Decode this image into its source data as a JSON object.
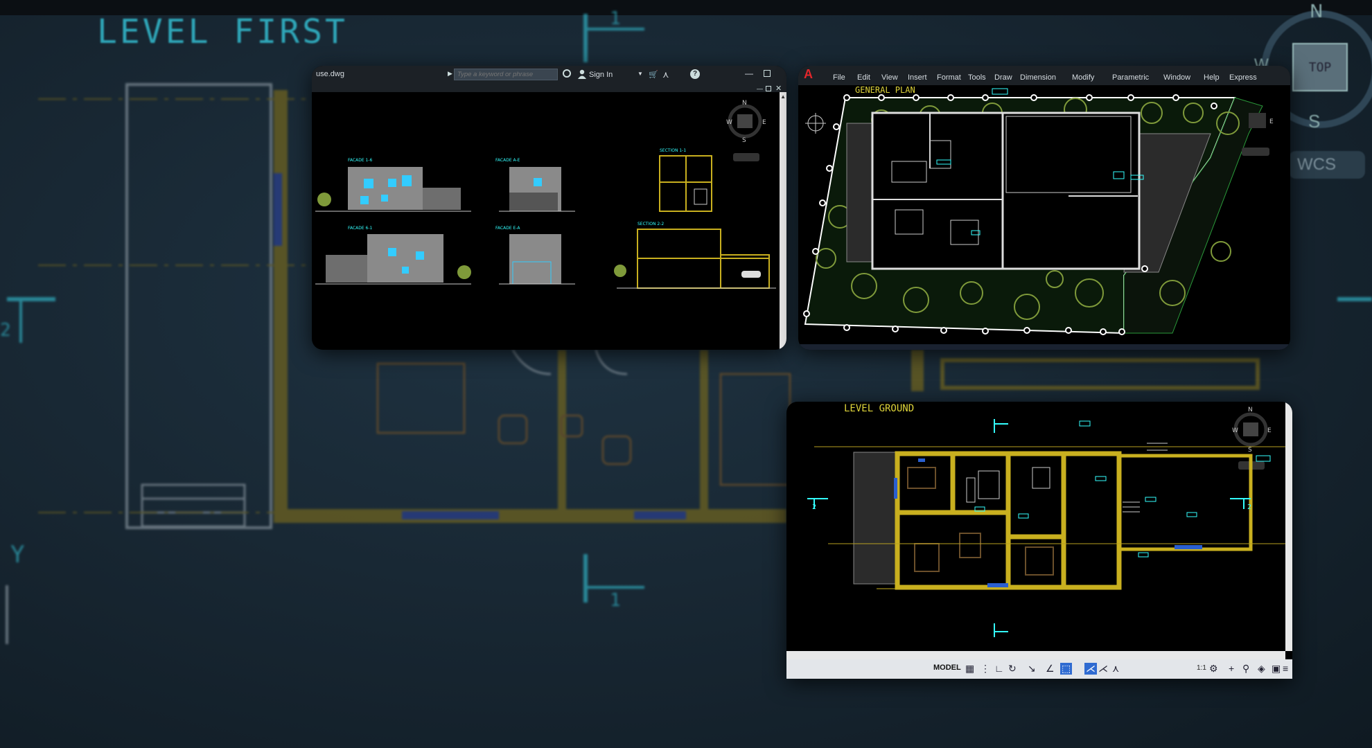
{
  "background": {
    "title": "LEVEL FIRST",
    "grid_markers": [
      "1",
      "2",
      "1"
    ],
    "axis_label": "Y"
  },
  "viewcube": {
    "north": "N",
    "west": "W",
    "south": "S",
    "top_label": "TOP",
    "ucs_label": "WCS"
  },
  "window_elevations": {
    "file_name": "use.dwg",
    "search_placeholder": "Type a keyword or phrase",
    "sign_in": "Sign In",
    "drawings": [
      {
        "label": "FACADE 1-6"
      },
      {
        "label": "FACADE A-E"
      },
      {
        "label": "SECTION 1-1"
      },
      {
        "label": "FACADE 6-1"
      },
      {
        "label": "FACADE E-A"
      },
      {
        "label": "SECTION 2-2"
      }
    ],
    "compass": {
      "n": "N",
      "w": "W",
      "e": "E",
      "s": "S"
    }
  },
  "window_general_plan": {
    "menu": [
      "File",
      "Edit",
      "View",
      "Insert",
      "Format",
      "Tools",
      "Draw",
      "Dimension",
      "Modify",
      "Parametric",
      "Window",
      "Help",
      "Express"
    ],
    "title": "GENERAL PLAN",
    "compass": {
      "e": "E"
    }
  },
  "window_level_ground": {
    "title": "LEVEL GROUND",
    "compass": {
      "n": "N",
      "w": "W",
      "e": "E",
      "s": "S"
    },
    "markers": [
      "2",
      "2"
    ],
    "status_bar": {
      "model_tab": "MODEL",
      "scale": "1:1"
    }
  },
  "colors": {
    "wall_yellow": "#c9b01f",
    "cyan": "#33ffff",
    "autocad_red": "#e3262b",
    "vegetation": "#7f9a3a",
    "bg_dark": "#1a2a36"
  }
}
